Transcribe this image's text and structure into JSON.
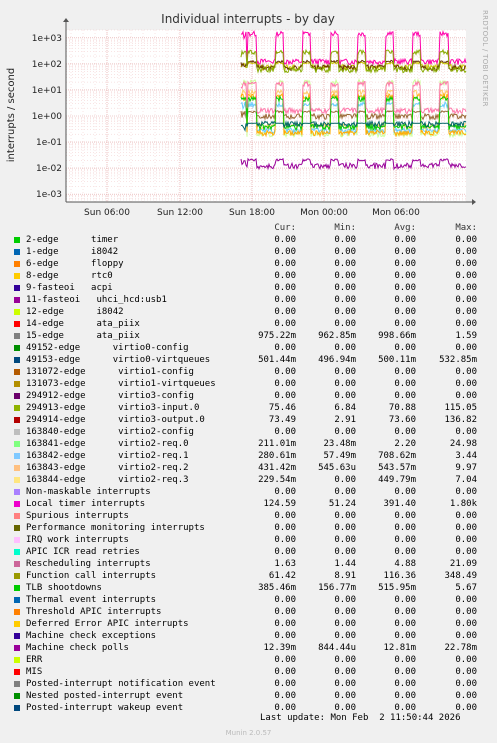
{
  "chart_data": {
    "type": "line",
    "title": "Individual interrupts - by day",
    "ylabel": "interrupts / second",
    "yscale": "log",
    "ylim": [
      0.0005,
      2000
    ],
    "yticks": [
      "1e-03",
      "1e-02",
      "1e-01",
      "1e+00",
      "1e+01",
      "1e+02",
      "1e+03"
    ],
    "xticks": [
      "Sun 06:00",
      "Sun 12:00",
      "Sun 18:00",
      "Mon 00:00",
      "Mon 06:00"
    ],
    "grid": true,
    "data_start": "Sun 17:00",
    "series_summary": [
      {
        "name": "Local timer interrupts",
        "color": "#ff00aa",
        "level": 124.59,
        "peak": 1800
      },
      {
        "name": "15-edge ata_piix",
        "color": "#996633",
        "level": 0.975,
        "peak": 1.59
      },
      {
        "name": "294913-edge virtio3-input.0",
        "color": "#cccc00",
        "level": 75.46,
        "peak": 115.05
      },
      {
        "name": "294914-edge virtio3-output.0",
        "color": "#663300",
        "level": 73.49,
        "peak": 136.82
      },
      {
        "name": "Function call interrupts",
        "color": "#88aa00",
        "level": 61.42,
        "peak": 348.49
      },
      {
        "name": "163841-edge virtio2-req.0",
        "color": "#ccff99",
        "level": 0.211,
        "peak": 24.98
      },
      {
        "name": "163842-edge virtio2-req.1",
        "color": "#66ccff",
        "level": 0.2806,
        "peak": 3.44
      },
      {
        "name": "163843-edge virtio2-req.2",
        "color": "#ffcc66",
        "level": 0.4313,
        "peak": 9.97
      },
      {
        "name": "163844-edge virtio2-req.3",
        "color": "#ffaa00",
        "level": 0.2296,
        "peak": 7.04
      },
      {
        "name": "TLB shootdowns",
        "color": "#00cc00",
        "level": 0.385,
        "peak": 5.67
      },
      {
        "name": "Rescheduling interrupts",
        "color": "#ff77aa",
        "level": 1.63,
        "peak": 21.09
      },
      {
        "name": "49153-edge virtio0-virtqueues",
        "color": "#006666",
        "level": 0.5014,
        "peak": 0.53285
      },
      {
        "name": "Machine check polls",
        "color": "#990099",
        "level": 0.01239,
        "peak": 0.02278
      }
    ]
  },
  "side_text": "RRDTOOL / TOBI OETIKER",
  "legend": {
    "headers": {
      "cur": "Cur:",
      "min": "Min:",
      "avg": "Avg:",
      "max": "Max:"
    },
    "rows": [
      {
        "name": "2-edge      timer",
        "color": "#00cc00",
        "cur": "0.00",
        "min": "0.00",
        "avg": "0.00",
        "max": "0.00"
      },
      {
        "name": "1-edge      i8042",
        "color": "#0066b3",
        "cur": "0.00",
        "min": "0.00",
        "avg": "0.00",
        "max": "0.00"
      },
      {
        "name": "6-edge      floppy",
        "color": "#ff8000",
        "cur": "0.00",
        "min": "0.00",
        "avg": "0.00",
        "max": "0.00"
      },
      {
        "name": "8-edge      rtc0",
        "color": "#ffcc00",
        "cur": "0.00",
        "min": "0.00",
        "avg": "0.00",
        "max": "0.00"
      },
      {
        "name": "9-fasteoi   acpi",
        "color": "#330099",
        "cur": "0.00",
        "min": "0.00",
        "avg": "0.00",
        "max": "0.00"
      },
      {
        "name": "11-fasteoi   uhci_hcd:usb1",
        "color": "#990099",
        "cur": "0.00",
        "min": "0.00",
        "avg": "0.00",
        "max": "0.00"
      },
      {
        "name": "12-edge      i8042",
        "color": "#ccff00",
        "cur": "0.00",
        "min": "0.00",
        "avg": "0.00",
        "max": "0.00"
      },
      {
        "name": "14-edge      ata_piix",
        "color": "#ff0000",
        "cur": "0.00",
        "min": "0.00",
        "avg": "0.00",
        "max": "0.00"
      },
      {
        "name": "15-edge      ata_piix",
        "color": "#808080",
        "cur": "975.22m",
        "min": "962.85m",
        "avg": "998.66m",
        "max": "1.59"
      },
      {
        "name": "49152-edge      virtio0-config",
        "color": "#008f00",
        "cur": "0.00",
        "min": "0.00",
        "avg": "0.00",
        "max": "0.00"
      },
      {
        "name": "49153-edge      virtio0-virtqueues",
        "color": "#00487d",
        "cur": "501.44m",
        "min": "496.94m",
        "avg": "500.11m",
        "max": "532.85m"
      },
      {
        "name": "131072-edge      virtio1-config",
        "color": "#b35a00",
        "cur": "0.00",
        "min": "0.00",
        "avg": "0.00",
        "max": "0.00"
      },
      {
        "name": "131073-edge      virtio1-virtqueues",
        "color": "#b38f00",
        "cur": "0.00",
        "min": "0.00",
        "avg": "0.00",
        "max": "0.00"
      },
      {
        "name": "294912-edge      virtio3-config",
        "color": "#6b006b",
        "cur": "0.00",
        "min": "0.00",
        "avg": "0.00",
        "max": "0.00"
      },
      {
        "name": "294913-edge      virtio3-input.0",
        "color": "#8fb300",
        "cur": "75.46",
        "min": "6.84",
        "avg": "70.88",
        "max": "115.05"
      },
      {
        "name": "294914-edge      virtio3-output.0",
        "color": "#b30000",
        "cur": "73.49",
        "min": "2.91",
        "avg": "73.60",
        "max": "136.82"
      },
      {
        "name": "163840-edge      virtio2-config",
        "color": "#bebebe",
        "cur": "0.00",
        "min": "0.00",
        "avg": "0.00",
        "max": "0.00"
      },
      {
        "name": "163841-edge      virtio2-req.0",
        "color": "#80ff80",
        "cur": "211.01m",
        "min": "23.48m",
        "avg": "2.20",
        "max": "24.98"
      },
      {
        "name": "163842-edge      virtio2-req.1",
        "color": "#80c9ff",
        "cur": "280.61m",
        "min": "57.49m",
        "avg": "708.62m",
        "max": "3.44"
      },
      {
        "name": "163843-edge      virtio2-req.2",
        "color": "#ffc080",
        "cur": "431.42m",
        "min": "545.63u",
        "avg": "543.57m",
        "max": "9.97"
      },
      {
        "name": "163844-edge      virtio2-req.3",
        "color": "#ffe680",
        "cur": "229.54m",
        "min": "0.00",
        "avg": "449.79m",
        "max": "7.04"
      },
      {
        "name": "Non-maskable interrupts",
        "color": "#aa80ff",
        "cur": "0.00",
        "min": "0.00",
        "avg": "0.00",
        "max": "0.00"
      },
      {
        "name": "Local timer interrupts",
        "color": "#ee00cc",
        "cur": "124.59",
        "min": "51.24",
        "avg": "391.40",
        "max": "1.80k"
      },
      {
        "name": "Spurious interrupts",
        "color": "#ff8080",
        "cur": "0.00",
        "min": "0.00",
        "avg": "0.00",
        "max": "0.00"
      },
      {
        "name": "Performance monitoring interrupts",
        "color": "#666600",
        "cur": "0.00",
        "min": "0.00",
        "avg": "0.00",
        "max": "0.00"
      },
      {
        "name": "IRQ work interrupts",
        "color": "#ffbfff",
        "cur": "0.00",
        "min": "0.00",
        "avg": "0.00",
        "max": "0.00"
      },
      {
        "name": "APIC ICR read retries",
        "color": "#00ffcc",
        "cur": "0.00",
        "min": "0.00",
        "avg": "0.00",
        "max": "0.00"
      },
      {
        "name": "Rescheduling interrupts",
        "color": "#cc6699",
        "cur": "1.63",
        "min": "1.44",
        "avg": "4.88",
        "max": "21.09"
      },
      {
        "name": "Function call interrupts",
        "color": "#999900",
        "cur": "61.42",
        "min": "8.91",
        "avg": "116.36",
        "max": "348.49"
      },
      {
        "name": "TLB shootdowns",
        "color": "#00cc00",
        "cur": "385.46m",
        "min": "156.77m",
        "avg": "515.95m",
        "max": "5.67"
      },
      {
        "name": "Thermal event interrupts",
        "color": "#0066b3",
        "cur": "0.00",
        "min": "0.00",
        "avg": "0.00",
        "max": "0.00"
      },
      {
        "name": "Threshold APIC interrupts",
        "color": "#ff8000",
        "cur": "0.00",
        "min": "0.00",
        "avg": "0.00",
        "max": "0.00"
      },
      {
        "name": "Deferred Error APIC interrupts",
        "color": "#ffcc00",
        "cur": "0.00",
        "min": "0.00",
        "avg": "0.00",
        "max": "0.00"
      },
      {
        "name": "Machine check exceptions",
        "color": "#330099",
        "cur": "0.00",
        "min": "0.00",
        "avg": "0.00",
        "max": "0.00"
      },
      {
        "name": "Machine check polls",
        "color": "#990099",
        "cur": "12.39m",
        "min": "844.44u",
        "avg": "12.81m",
        "max": "22.78m"
      },
      {
        "name": "ERR",
        "color": "#ccff00",
        "cur": "0.00",
        "min": "0.00",
        "avg": "0.00",
        "max": "0.00"
      },
      {
        "name": "MIS",
        "color": "#ff0000",
        "cur": "0.00",
        "min": "0.00",
        "avg": "0.00",
        "max": "0.00"
      },
      {
        "name": "Posted-interrupt notification event",
        "color": "#808080",
        "cur": "0.00",
        "min": "0.00",
        "avg": "0.00",
        "max": "0.00"
      },
      {
        "name": "Nested posted-interrupt event",
        "color": "#008f00",
        "cur": "0.00",
        "min": "0.00",
        "avg": "0.00",
        "max": "0.00"
      },
      {
        "name": "Posted-interrupt wakeup event",
        "color": "#00487d",
        "cur": "0.00",
        "min": "0.00",
        "avg": "0.00",
        "max": "0.00"
      }
    ]
  },
  "footer": {
    "last_update": "Last update: Mon Feb  2 11:50:44 2026",
    "munin": "Munin 2.0.57"
  }
}
